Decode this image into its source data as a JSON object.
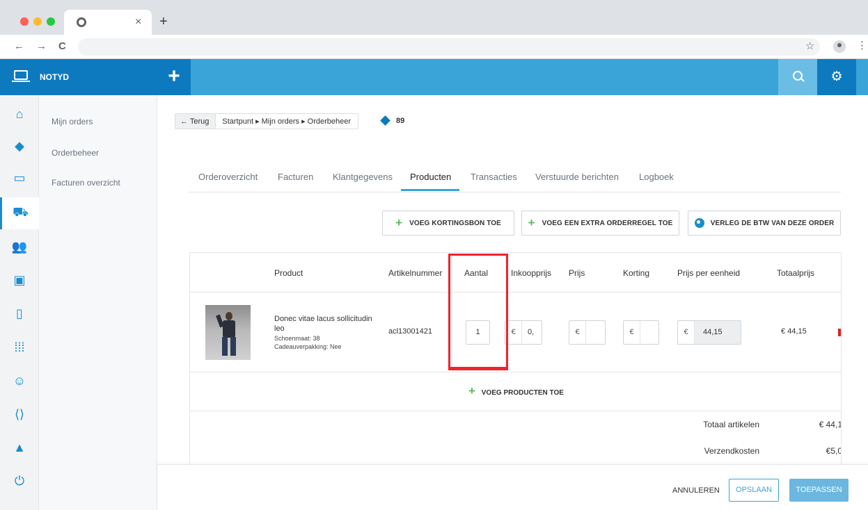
{
  "browser": {
    "tab_close": "×",
    "new_tab": "+",
    "back": "←",
    "forward": "→",
    "reload": "C",
    "star": "☆",
    "menu": "⋮"
  },
  "app": {
    "brand": "NOTYD",
    "plus": "+",
    "gear": "⚙"
  },
  "sidebar": {
    "icons": [
      "home-icon",
      "layers-icon",
      "laptop-icon",
      "cart-icon",
      "users-icon",
      "briefcase-icon",
      "clipboard-icon",
      "grid-icon",
      "smiley-icon",
      "code-icon",
      "graduation-icon",
      "power-icon"
    ],
    "items": [
      {
        "label": "Mijn orders"
      },
      {
        "label": "Orderbeheer"
      },
      {
        "label": "Facturen overzicht"
      }
    ]
  },
  "breadcrumb": {
    "back_label": "← Terug",
    "path": "Startpunt ▸ Mijn orders ▸ Orderbeheer",
    "count": "89"
  },
  "tabs": [
    {
      "label": "Orderoverzicht"
    },
    {
      "label": "Facturen"
    },
    {
      "label": "Klantgegevens"
    },
    {
      "label": "Producten"
    },
    {
      "label": "Transacties"
    },
    {
      "label": "Verstuurde berichten"
    },
    {
      "label": "Logboek"
    }
  ],
  "actions": {
    "coupon": "VOEG KORTINGSBON TOE",
    "extra_line": "VOEG EEN EXTRA ORDERREGEL TOE",
    "vat": "VERLEG DE BTW VAN DEZE ORDER"
  },
  "table": {
    "headers": {
      "product": "Product",
      "sku": "Artikelnummer",
      "quantity": "Aantal",
      "purchase_price": "Inkoopprijs",
      "price": "Prijs",
      "discount": "Korting",
      "unit_price": "Prijs per eenheid",
      "total": "Totaalprijs"
    },
    "row": {
      "name": "Donec vitae lacus sollicitudin leo",
      "shoe_size": "Schoenmaat: 38",
      "gift_wrap": "Cadeauverpakking: Nee",
      "sku": "acl13001421",
      "quantity": "1",
      "currency": "€",
      "purchase_price": "0,",
      "price": "",
      "discount": "",
      "unit_price": "44,15",
      "total": "€ 44,15"
    },
    "add_products": "VOEG PRODUCTEN TOE",
    "summary": [
      {
        "label": "Totaal artikelen",
        "value": "€ 44,1"
      },
      {
        "label": "Verzendkosten",
        "value": "€5,0"
      }
    ]
  },
  "footer": {
    "cancel": "ANNULEREN",
    "save": "OPSLAAN",
    "apply": "TOEPASSEN"
  }
}
